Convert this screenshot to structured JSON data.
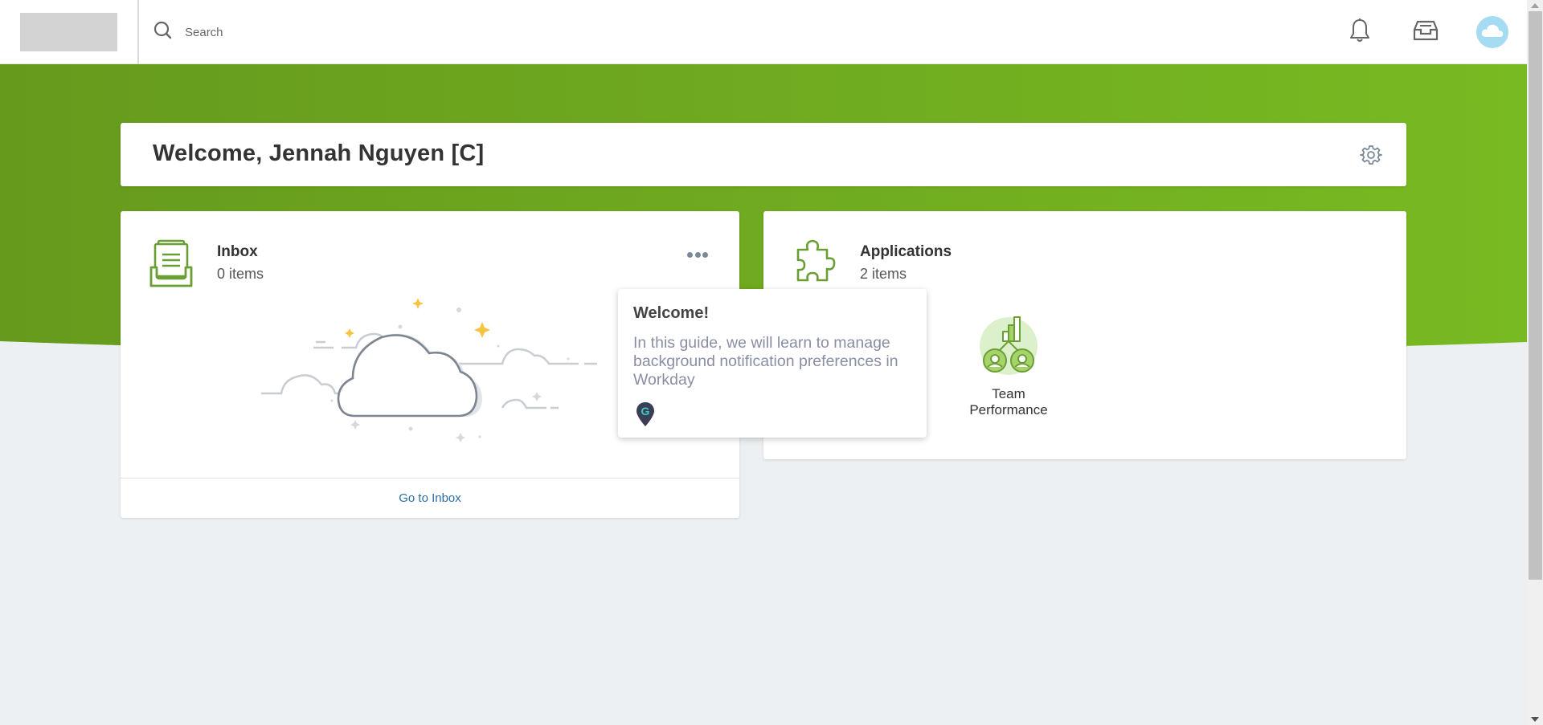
{
  "topbar": {
    "search_placeholder": "Search",
    "icons": {
      "search": "search-icon",
      "notifications": "bell-icon",
      "inbox": "inbox-tray-icon",
      "avatar": "cloud-avatar-icon"
    }
  },
  "colors": {
    "brand_green": "#6a9f1e",
    "banner_green_light": "#78b922",
    "link_blue": "#2a6ea6",
    "avatar_blue": "#a6dcf3",
    "page_bg": "#edf0f2"
  },
  "welcome": {
    "title": "Welcome, Jennah Nguyen [C]",
    "settings_icon": "gear-icon"
  },
  "inbox": {
    "title": "Inbox",
    "count": "0 items",
    "footer_link": "Go to Inbox",
    "illustration": "empty-cloud-illustration"
  },
  "applications": {
    "title": "Applications",
    "count": "2 items",
    "tiles": [
      {
        "label_line1": "Team",
        "label_line2": "Performance",
        "icon": "team-performance-icon"
      }
    ]
  },
  "tooltip": {
    "title": "Welcome!",
    "body": "In this guide, we will learn to manage background notification preferences in Workday",
    "badge_icon": "guide-pin-icon",
    "badge_letter": "G"
  }
}
